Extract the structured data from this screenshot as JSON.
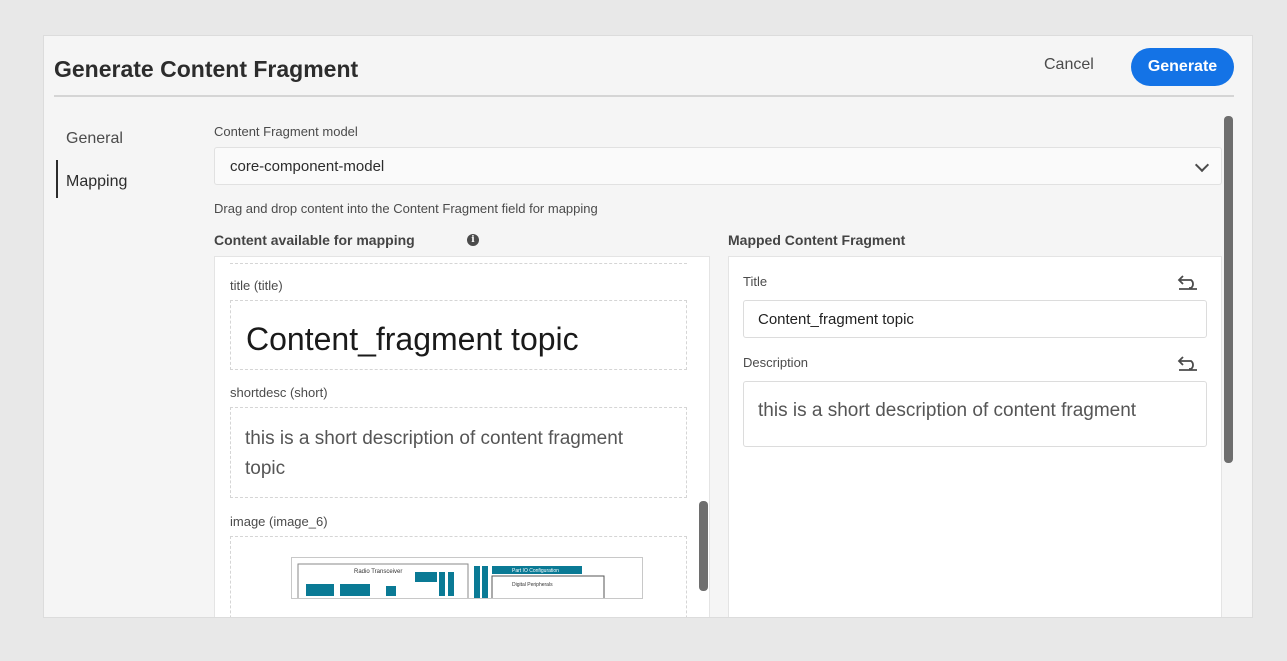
{
  "dialog": {
    "title": "Generate Content Fragment",
    "cancel_label": "Cancel",
    "generate_label": "Generate"
  },
  "nav": {
    "items": [
      {
        "label": "General",
        "active": false
      },
      {
        "label": "Mapping",
        "active": true
      }
    ]
  },
  "model": {
    "label": "Content Fragment model",
    "value": "core-component-model"
  },
  "instructions": "Drag and drop content into the Content Fragment field for mapping",
  "available": {
    "heading": "Content available for mapping",
    "items": [
      {
        "label": "title (title)",
        "content": "Content_fragment topic"
      },
      {
        "label": "shortdesc (short)",
        "content": "this is a short description of content fragment topic"
      },
      {
        "label": "image (image_6)",
        "content": "",
        "diagram_texts": [
          "Radio Transceiver",
          "Part IO Configuration",
          "Digital Peripherals"
        ]
      }
    ]
  },
  "mapped": {
    "heading": "Mapped Content Fragment",
    "fields": [
      {
        "label": "Title",
        "value": "Content_fragment topic"
      },
      {
        "label": "Description",
        "value": "this is a short description of content fragment"
      }
    ]
  },
  "colors": {
    "accent": "#1473e6",
    "background": "#e8e8e8",
    "dialog": "#f5f5f5",
    "diagram_teal": "#0a7a95"
  },
  "icons": {
    "select": "chevron-down-icon",
    "info": "info-icon",
    "reset": "undo-icon"
  }
}
